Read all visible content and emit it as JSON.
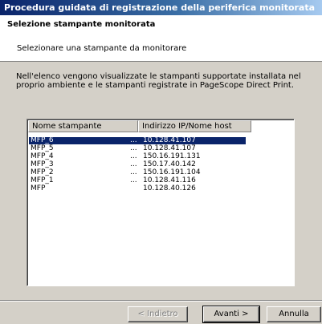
{
  "window": {
    "title": "Procedura guidata di registrazione della periferica monitorata"
  },
  "header": {
    "title": "Selezione stampante monitorata",
    "subtitle": "Selezionare una stampante da monitorare"
  },
  "description": "Nell'elenco vengono visualizzate le stampanti supportate installata nel proprio ambiente e le stampanti registrate in PageScope Direct Print.",
  "printer_list": {
    "columns": [
      "Nome stampante",
      "Indirizzo IP/Nome host"
    ],
    "rows": [
      {
        "name": "MFP_6",
        "dots": "...",
        "ip": "10.128.41.107",
        "selected": true
      },
      {
        "name": "MFP_5",
        "dots": "...",
        "ip": "10.128.41.107",
        "selected": false
      },
      {
        "name": "MFP_4",
        "dots": "...",
        "ip": "150.16.191.131",
        "selected": false
      },
      {
        "name": "MFP_3",
        "dots": "...",
        "ip": "150.17.40.142",
        "selected": false
      },
      {
        "name": "MFP_2",
        "dots": "...",
        "ip": "150.16.191.104",
        "selected": false
      },
      {
        "name": "MFP_1",
        "dots": "...",
        "ip": "10.128.41.116",
        "selected": false
      },
      {
        "name": "MFP",
        "dots": "",
        "ip": "10.128.40.126",
        "selected": false
      }
    ]
  },
  "buttons": {
    "back_label": "< Indietro",
    "next_label": "Avanti >",
    "cancel_label": "Annulla"
  },
  "colors": {
    "titlebar_start": "#0a246a",
    "selection": "#0a246a",
    "dialog_face": "#d4d0c8"
  }
}
